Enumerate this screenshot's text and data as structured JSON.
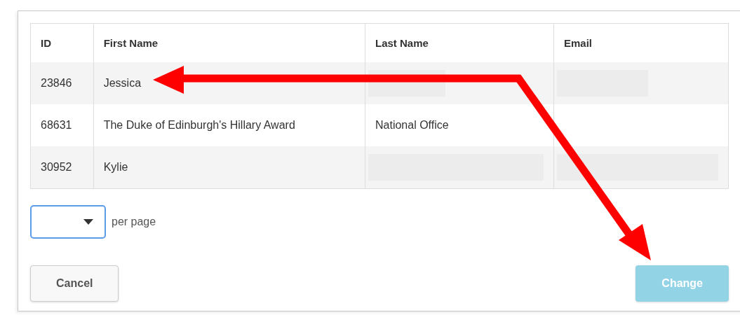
{
  "table": {
    "columns": [
      "ID",
      "First Name",
      "Last Name",
      "Email"
    ],
    "rows": [
      {
        "cells": [
          {
            "kind": "text",
            "text": "23846"
          },
          {
            "kind": "text",
            "text": "Jessica"
          },
          {
            "kind": "redacted"
          },
          {
            "kind": "redacted"
          }
        ]
      },
      {
        "cells": [
          {
            "kind": "text",
            "text": "68631"
          },
          {
            "kind": "text",
            "text": "The Duke of Edinburgh's Hillary Award"
          },
          {
            "kind": "text",
            "text": "National Office"
          },
          {
            "kind": "empty"
          }
        ]
      },
      {
        "cells": [
          {
            "kind": "text",
            "text": "30952"
          },
          {
            "kind": "text",
            "text": "Kylie"
          },
          {
            "kind": "redacted"
          },
          {
            "kind": "redacted"
          }
        ]
      }
    ]
  },
  "page_size": {
    "label": "per page"
  },
  "buttons": [
    {
      "label": "Cancel",
      "kind": "secondary",
      "disabled": false
    },
    {
      "label": "Change",
      "kind": "primary",
      "disabled": true
    }
  ]
}
